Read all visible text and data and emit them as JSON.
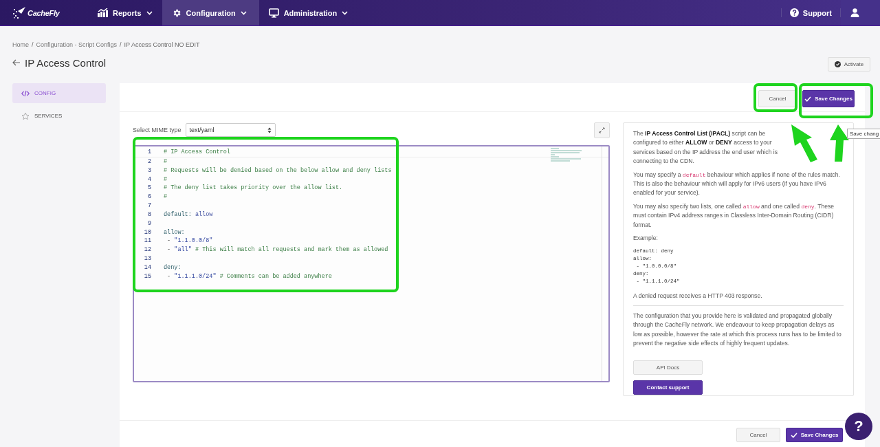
{
  "navbar": {
    "logo": "CacheFly",
    "menus": [
      {
        "label": "Reports",
        "selected": false
      },
      {
        "label": "Configuration",
        "selected": true
      },
      {
        "label": "Administration",
        "selected": false
      }
    ],
    "support": "Support"
  },
  "breadcrumb": {
    "items": [
      "Home",
      "Configuration - Script Configs",
      "IP Access Control NO EDIT"
    ],
    "separators": [
      "/",
      "/"
    ]
  },
  "page_title": "IP Access Control",
  "activate_button": "Activate",
  "sidebar": {
    "items": [
      {
        "label": "CONFIG",
        "selected": true
      },
      {
        "label": "SERVICES",
        "selected": false
      }
    ]
  },
  "header_actions": {
    "cancel": "Cancel",
    "save": "Save Changes",
    "tooltip": "Save chang"
  },
  "mime": {
    "label": "Select MIME type",
    "value": "text/yaml"
  },
  "editor": {
    "lines": [
      {
        "number": "1",
        "segments": [
          {
            "kind": "comment",
            "text": "# IP Access Control"
          }
        ]
      },
      {
        "number": "2",
        "segments": [
          {
            "kind": "comment",
            "text": "#"
          }
        ]
      },
      {
        "number": "3",
        "segments": [
          {
            "kind": "comment",
            "text": "# Requests will be denied based on the below allow and deny lists"
          }
        ]
      },
      {
        "number": "4",
        "segments": [
          {
            "kind": "comment",
            "text": "#"
          }
        ]
      },
      {
        "number": "5",
        "segments": [
          {
            "kind": "comment",
            "text": "# The deny list takes priority over the allow list."
          }
        ]
      },
      {
        "number": "6",
        "segments": [
          {
            "kind": "comment",
            "text": "#"
          }
        ]
      },
      {
        "number": "7"
      },
      {
        "number": "8",
        "segments": [
          {
            "kind": "key",
            "text": "default:"
          },
          {
            "kind": "value",
            "text": " allow"
          }
        ]
      },
      {
        "number": "9"
      },
      {
        "number": "10",
        "segments": [
          {
            "kind": "key",
            "text": "allow:"
          }
        ]
      },
      {
        "number": "11",
        "segments": [
          {
            "kind": "plain",
            "text": " - "
          },
          {
            "kind": "string",
            "text": "\"1.1.0.0/8\""
          }
        ]
      },
      {
        "number": "12",
        "segments": [
          {
            "kind": "plain",
            "text": " - "
          },
          {
            "kind": "string",
            "text": "\"all\""
          },
          {
            "kind": "comment",
            "text": " # This will match all requests and mark them as allowed"
          }
        ]
      },
      {
        "number": "13"
      },
      {
        "number": "14",
        "segments": [
          {
            "kind": "key",
            "text": "deny:"
          }
        ]
      },
      {
        "number": "15",
        "segments": [
          {
            "kind": "plain",
            "text": " - "
          },
          {
            "kind": "string",
            "text": "\"1.1.1.0/24\""
          },
          {
            "kind": "comment",
            "text": " # Comments can be added anywhere"
          }
        ]
      }
    ]
  },
  "info": {
    "paragraphs": [
      {
        "kind": "text",
        "segments": [
          {
            "kind": "text",
            "text": "The **IP Access Control List (IPACL)** script can be configured to either **ALLOW** or **DENY** access to your services based on the IP address the end user which is connecting to the CDN."
          }
        ]
      },
      {
        "kind": "text",
        "segments": [
          {
            "kind": "text",
            "text": "You may specify a "
          },
          {
            "kind": "code",
            "text": "default"
          },
          {
            "kind": "text",
            "text": " behaviour which applies if none of the rules match. This is also the behaviour which will apply for IPv6 users (if you have IPv6 enabled for your service)."
          }
        ]
      },
      {
        "kind": "text",
        "segments": [
          {
            "kind": "text",
            "text": "You may also specify two lists, one called "
          },
          {
            "kind": "code",
            "text": "allow"
          },
          {
            "kind": "text",
            "text": " and one called "
          },
          {
            "kind": "code",
            "text": "deny"
          },
          {
            "kind": "text",
            "text": ". These must contain IPv4 address ranges in Classless Inter-Domain Routing (CIDR) format."
          }
        ]
      },
      {
        "kind": "text",
        "segments": [
          {
            "kind": "text",
            "text": "Example:"
          }
        ]
      },
      {
        "kind": "example",
        "lines": [
          "default: deny",
          "allow:",
          " - \"1.0.0.0/8\"",
          "deny:",
          " - \"1.1.1.0/24\""
        ]
      },
      {
        "kind": "text",
        "segments": [
          {
            "kind": "text",
            "text": "A denied request receives a HTTP 403 response."
          }
        ]
      },
      {
        "kind": "rule"
      },
      {
        "kind": "text",
        "segments": [
          {
            "kind": "text",
            "text": "The configuration that you provide here is validated and propagated globally through the CacheFly network. We endeavour to keep propagation delays as low as possible, however the rate at which this process runs has to be limited to prevent the negative side effects of highly frequent updates."
          }
        ]
      }
    ],
    "api_docs": "API Docs",
    "contact": "Contact support"
  },
  "footer_actions": {
    "cancel": "Cancel",
    "save": "Save Changes"
  },
  "help_button": "?"
}
